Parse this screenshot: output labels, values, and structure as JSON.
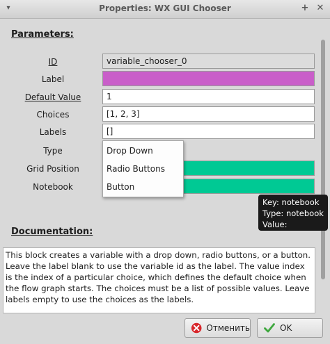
{
  "window": {
    "title": "Properties: WX GUI Chooser",
    "menu_glyph": "▾",
    "plus_glyph": "+",
    "close_glyph": "✕"
  },
  "parameters": {
    "heading": "Parameters:",
    "rows": [
      {
        "label": "ID",
        "value": "variable_chooser_0"
      },
      {
        "label": "Label",
        "value": "",
        "color": "#c95ec9"
      },
      {
        "label": "Default Value",
        "value": "1"
      },
      {
        "label": "Choices",
        "value": "[1, 2, 3]"
      },
      {
        "label": "Labels",
        "value": "[]"
      },
      {
        "label": "Type",
        "value": ""
      },
      {
        "label": "Grid Position",
        "value": "",
        "color": "#00c994"
      },
      {
        "label": "Notebook",
        "value": "",
        "color": "#00c994"
      }
    ]
  },
  "type_dropdown": {
    "options": [
      "Drop Down",
      "Radio Buttons",
      "Button"
    ]
  },
  "tooltip": {
    "lines": [
      "Key: notebook",
      "Type: notebook",
      "Value:"
    ]
  },
  "documentation": {
    "heading": "Documentation:",
    "text": "This block creates a variable with a drop down, radio buttons, or a button. Leave the label blank to use the variable id as the label. The value index is the index of a particular choice, which defines the default choice when the flow graph starts. The choices must be a list of possible values. Leave labels empty to use the choices as the labels."
  },
  "buttons": {
    "cancel": "Отменить",
    "ok": "OK"
  },
  "icons": {
    "cancel": "cancel-icon",
    "ok": "checkmark-icon"
  }
}
